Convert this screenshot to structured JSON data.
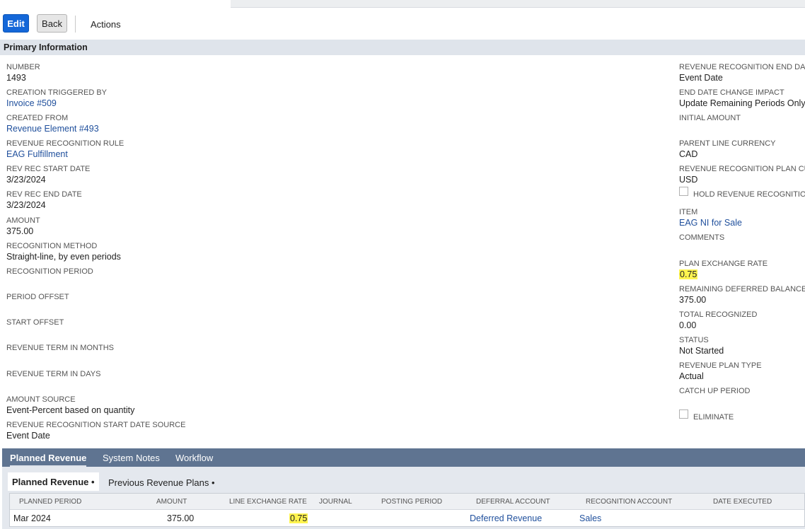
{
  "toolbar": {
    "edit_label": "Edit",
    "back_label": "Back",
    "actions_label": "Actions"
  },
  "section_title": "Primary Information",
  "left_fields": [
    {
      "label": "NUMBER",
      "value": "1493"
    },
    {
      "label": "CREATION TRIGGERED BY",
      "value": "Invoice #509"
    },
    {
      "label": "CREATED FROM",
      "value": "Revenue Element #493"
    },
    {
      "label": "REVENUE RECOGNITION RULE",
      "value": "EAG Fulfillment"
    },
    {
      "label": "REV REC START DATE",
      "value": "3/23/2024"
    },
    {
      "label": "REV REC END DATE",
      "value": "3/23/2024"
    },
    {
      "label": "AMOUNT",
      "value": "375.00"
    },
    {
      "label": "RECOGNITION METHOD",
      "value": "Straight-line, by even periods"
    },
    {
      "label": "RECOGNITION PERIOD",
      "value": ""
    },
    {
      "label": "PERIOD OFFSET",
      "value": ""
    },
    {
      "label": "START OFFSET",
      "value": ""
    },
    {
      "label": "REVENUE TERM IN MONTHS",
      "value": ""
    },
    {
      "label": "REVENUE TERM IN DAYS",
      "value": ""
    },
    {
      "label": "AMOUNT SOURCE",
      "value": "Event-Percent based on quantity"
    },
    {
      "label": "REVENUE RECOGNITION START DATE SOURCE",
      "value": "Event Date"
    }
  ],
  "right_fields": [
    {
      "label": "REVENUE RECOGNITION END DATE",
      "value": "Event Date"
    },
    {
      "label": "END DATE CHANGE IMPACT",
      "value": "Update Remaining Periods Only"
    },
    {
      "label": "INITIAL AMOUNT",
      "value": ""
    },
    {
      "label": "PARENT LINE CURRENCY",
      "value": "CAD"
    },
    {
      "label": "REVENUE RECOGNITION PLAN CURR",
      "value": "USD"
    },
    {
      "label": "HOLD REVENUE RECOGNITION",
      "value": ""
    },
    {
      "label": "ITEM",
      "value": "EAG NI for Sale"
    },
    {
      "label": "COMMENTS",
      "value": ""
    },
    {
      "label": "PLAN EXCHANGE RATE",
      "value": "0.75"
    },
    {
      "label": "REMAINING DEFERRED BALANCE",
      "value": "375.00"
    },
    {
      "label": "TOTAL RECOGNIZED",
      "value": "0.00"
    },
    {
      "label": "STATUS",
      "value": "Not Started"
    },
    {
      "label": "REVENUE PLAN TYPE",
      "value": "Actual"
    },
    {
      "label": "CATCH UP PERIOD",
      "value": ""
    },
    {
      "label": "ELIMINATE",
      "value": ""
    }
  ],
  "subtabs": [
    {
      "label": "Planned Revenue"
    },
    {
      "label": "System Notes"
    },
    {
      "label": "Workflow"
    }
  ],
  "inner_tabs": [
    {
      "label": "Planned Revenue",
      "dot": "•"
    },
    {
      "label": "Previous Revenue Plans",
      "dot": "•"
    }
  ],
  "table": {
    "columns": [
      "PLANNED PERIOD",
      "AMOUNT",
      "LINE EXCHANGE RATE",
      "JOURNAL",
      "POSTING PERIOD",
      "DEFERRAL ACCOUNT",
      "RECOGNITION ACCOUNT",
      "DATE EXECUTED"
    ],
    "rows": [
      {
        "planned_period": "Mar 2024",
        "amount": "375.00",
        "line_exchange_rate": "0.75",
        "journal": "",
        "posting_period": "",
        "deferral_account": "Deferred Revenue",
        "recognition_account": "Sales",
        "date_executed": ""
      }
    ]
  },
  "colors": {
    "accent": "#1467d8",
    "link": "#1f4f9c",
    "subtab_bar": "#5f7491",
    "section_bar": "#dfe4eb",
    "highlight": "#fff44f"
  }
}
